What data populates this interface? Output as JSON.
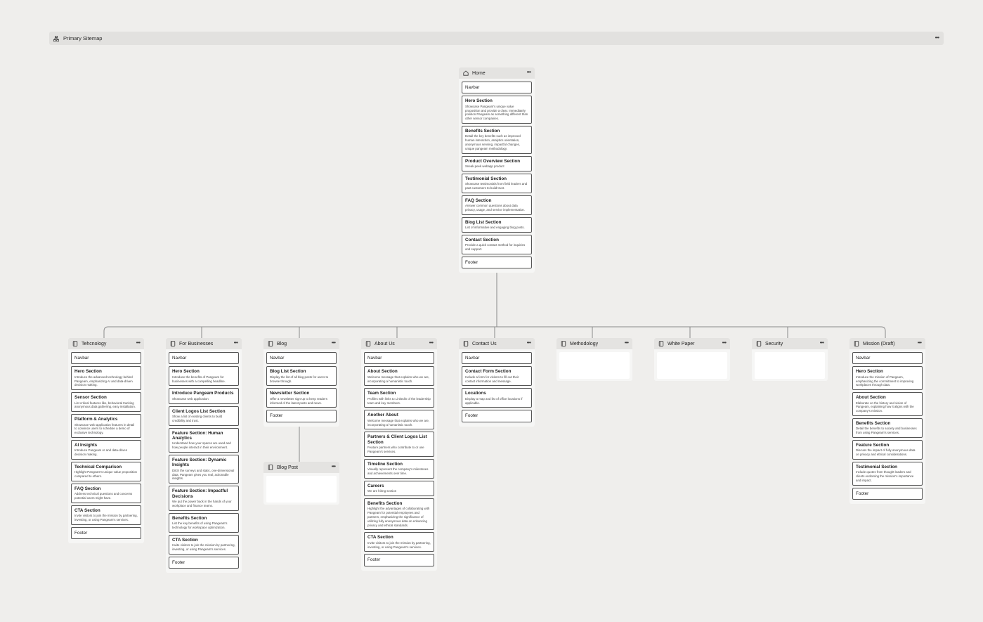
{
  "sitemap": {
    "title": "Primary Sitemap"
  },
  "pages": [
    {
      "id": "home",
      "name": "Home",
      "icon": "home-icon",
      "sections": [
        {
          "title": "Navbar"
        },
        {
          "title": "Hero Section",
          "desc": "Showcase Pangeam's unique value proposition and provide a clear. Immediately position Pangeam as something different than other sensor companies."
        },
        {
          "title": "Benefits Section",
          "desc": "Detail the key benefits such as improved human interaction, analytics orientation, anonymous sensing, impactful changes, unique pangeam methodology."
        },
        {
          "title": "Product Overview Section",
          "desc": "Sneak peek webapp product"
        },
        {
          "title": "Testimonial Section",
          "desc": "Showcase testimonials from field leaders and past customers to build trust."
        },
        {
          "title": "FAQ Section",
          "desc": "Answer common questions about data privacy, usage, and service implementation."
        },
        {
          "title": "Blog List Section",
          "desc": "List of informative and engaging blog posts."
        },
        {
          "title": "Contact Section",
          "desc": "Provide a quick contact method for inquiries and support."
        },
        {
          "title": "Footer"
        }
      ]
    },
    {
      "id": "technology",
      "name": "Tehcnology",
      "icon": "page-icon",
      "sections": [
        {
          "title": "Navbar"
        },
        {
          "title": "Hero Section",
          "desc": "Introduce the advanced technology behind Pangeam, emphasizing AI and data-driven decision making."
        },
        {
          "title": "Sensor Section",
          "desc": "List critical features like, behavioral tracking anonymous data gathering, easy installation."
        },
        {
          "title": "Platform & Analytics",
          "desc": "Showcase web application features in detail to convince users to schedule a demo of exclusive technology."
        },
        {
          "title": "AI Insights",
          "desc": "Introduce Pangeam AI and data-driven decision making."
        },
        {
          "title": "Technical Comparison",
          "desc": "Highlight Pangeam's unique value proposition compared to others."
        },
        {
          "title": "FAQ Section",
          "desc": "Address technical questions and concerns potential users might have."
        },
        {
          "title": "CTA Section",
          "desc": "Invite visitors to join the mission by partnering, investing, or using Pangeam's services."
        },
        {
          "title": "Footer"
        }
      ]
    },
    {
      "id": "businesses",
      "name": "For Businesses",
      "icon": "page-icon",
      "sections": [
        {
          "title": "Navbar"
        },
        {
          "title": "Hero Section",
          "desc": "Introduce the benefits of Pangeam for businesses with a compelling headline."
        },
        {
          "title": "Introduce Pangeam Products",
          "desc": "Showcase web application"
        },
        {
          "title": "Client Logos List Section",
          "desc": "Show a list of existing clients to build credibility and trust."
        },
        {
          "title": "Feature Section: Human Analytics",
          "desc": "Understand how your spaces are used and how people interact in their environment."
        },
        {
          "title": "Feature Section: Dynamic Insights",
          "desc": "Ditch the surveys and static, one-dimensional data. Pangeam gives you real, actionable insights."
        },
        {
          "title": "Feature Section: Impactful Decisions",
          "desc": "We put the power back in the hands of your workplace and finance teams."
        },
        {
          "title": "Benefits Section",
          "desc": "List the key benefits of using Pangeam's technology for workspace optimization."
        },
        {
          "title": "CTA Section",
          "desc": "Invite visitors to join the mission by partnering, investing, or using Pangeam's services."
        },
        {
          "title": "Footer"
        }
      ]
    },
    {
      "id": "blog",
      "name": "Blog",
      "icon": "page-icon",
      "sections": [
        {
          "title": "Navbar"
        },
        {
          "title": "Blog List Section",
          "desc": "Display the list of all blog posts for users to browse through."
        },
        {
          "title": "Newsletter Section",
          "desc": "Offer a newsletter sign-up to keep readers informed of the latest posts and news."
        },
        {
          "title": "Footer"
        }
      ]
    },
    {
      "id": "blogpost",
      "name": "Blog Post",
      "icon": "page-icon",
      "empty": true,
      "sections": []
    },
    {
      "id": "about",
      "name": "About Us",
      "icon": "page-icon",
      "sections": [
        {
          "title": "Navbar"
        },
        {
          "title": "About Section",
          "desc": "Welcome message that explains who we are, incorporating a humanistic touch."
        },
        {
          "title": "Team Section",
          "desc": "Profiles with links to Linkedin of the leadership team and key members."
        },
        {
          "title": "Another About",
          "desc": "Welcome message that explains who we are, incorporating a humanistic touch."
        },
        {
          "title": "Partners & Client Logos List Section",
          "desc": "Feature partners who contribute to or use Pangeam's services."
        },
        {
          "title": "Timeline Section",
          "desc": "Visually represent the company's milestones and achievements over time."
        },
        {
          "title": "Careers",
          "desc": "We are hiring section"
        },
        {
          "title": "Benefits Section",
          "desc": "Highlight the advantages of collaborating with Pangeam for potential employees and partners, emphasizing the significance of utilizing fully anonymous data on enhancing privacy and ethical standards."
        },
        {
          "title": "CTA Section",
          "desc": "Invite visitors to join the mission by partnering, investing, or using Pangeam's services."
        },
        {
          "title": "Footer"
        }
      ]
    },
    {
      "id": "contact",
      "name": "Contact Us",
      "icon": "page-icon",
      "sections": [
        {
          "title": "Navbar"
        },
        {
          "title": "Contact Form Section",
          "desc": "Include a form for visitors to fill out their contact information and message."
        },
        {
          "title": "Locations",
          "desc": "Display a map and list of office locations if applicable."
        },
        {
          "title": "Footer"
        }
      ]
    },
    {
      "id": "methodology",
      "name": "Methodology",
      "icon": "page-icon",
      "empty": true,
      "sections": []
    },
    {
      "id": "whitepaper",
      "name": "White Paper",
      "icon": "page-icon",
      "empty": true,
      "sections": []
    },
    {
      "id": "security",
      "name": "Security",
      "icon": "page-icon",
      "empty": true,
      "sections": []
    },
    {
      "id": "mission",
      "name": "Mission (Draft)",
      "icon": "page-icon",
      "sections": [
        {
          "title": "Navbar"
        },
        {
          "title": "Hero Section",
          "desc": "Introduce the mission of Pangeam, emphasizing the commitment to improving workplaces through data."
        },
        {
          "title": "About Section",
          "desc": "Elaborate on the history and vision of Pangeam, explaining how it aligns with the company's mission."
        },
        {
          "title": "Benefits Section",
          "desc": "Detail the benefits to society and businesses from using Pangeam's services."
        },
        {
          "title": "Feature Section",
          "desc": "Discuss the impact of fully anonymous data on privacy and ethical considerations."
        },
        {
          "title": "Testimonial Section",
          "desc": "Include quotes from thought leaders and clients endorsing the mission's importance and impact."
        },
        {
          "title": "Footer"
        }
      ]
    }
  ]
}
